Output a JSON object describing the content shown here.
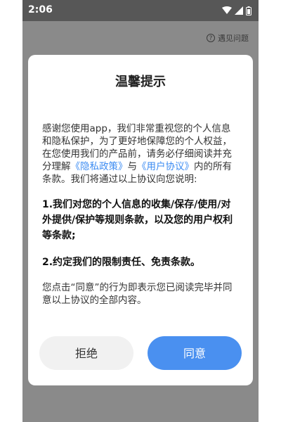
{
  "status_bar": {
    "time": "2:06"
  },
  "header": {
    "faq_label": "遇见问题",
    "faq_icon": "help-circle-icon"
  },
  "dialog": {
    "title": "温馨提示",
    "intro": {
      "part1": "感谢您使用app，我们非常重视您的个人信息和隐私保护，为了更好地保障您的个人权益，在您使用我们的产品前，请务必仔细阅读并充分理解",
      "privacy_link": "《隐私政策》",
      "part2": "与",
      "agreement_link": "《用户协议》",
      "part3": "内的所有条款。我们将通过以上协议向您说明:"
    },
    "point1": "1.我们对您的个人信息的收集/保存/使用/对外提供/保护等规则条款，以及您的用户权利等条款;",
    "point2": "2.约定我们的限制责任、免责条款。",
    "closing": "您点击“同意”的行为即表示您已阅读完毕并同意以上协议的全部内容。",
    "reject_label": "拒绝",
    "agree_label": "同意"
  },
  "colors": {
    "accent": "#4a90f0",
    "link": "#3b8bf2",
    "overlay": "#8a8a8a"
  }
}
